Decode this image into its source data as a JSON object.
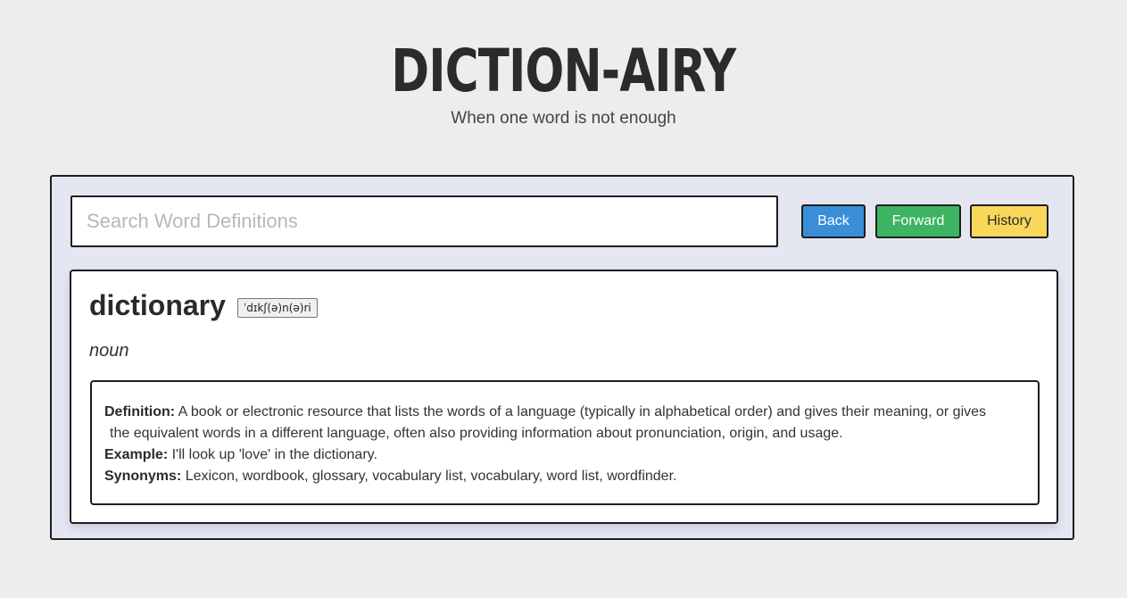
{
  "header": {
    "logo": "DICTION-AIRY",
    "tagline": "When one word is not enough"
  },
  "search": {
    "placeholder": "Search Word Definitions",
    "value": ""
  },
  "nav": {
    "back_label": "Back",
    "forward_label": "Forward",
    "history_label": "History"
  },
  "entry": {
    "word": "dictionary",
    "phonetic": "ˈdɪkʃ(ə)n(ə)ri",
    "part_of_speech": "noun",
    "definition_label": "Definition:",
    "definition_line1": "A book or electronic resource that lists the words of a language (typically in alphabetical order) and gives their meaning, or gives",
    "definition_line2": "the equivalent words in a different language, often also providing information about pronunciation, origin, and usage.",
    "example_label": "Example:",
    "example": "I'll look up 'love' in the dictionary.",
    "synonyms_label": "Synonyms:",
    "synonyms": "Lexicon, wordbook, glossary, vocabulary list, vocabulary, word list, wordfinder."
  },
  "colors": {
    "background": "#ededed",
    "panel": "#e4e6f2",
    "back_button": "#3a8ed8",
    "forward_button": "#3cb463",
    "history_button": "#f8d85a"
  }
}
